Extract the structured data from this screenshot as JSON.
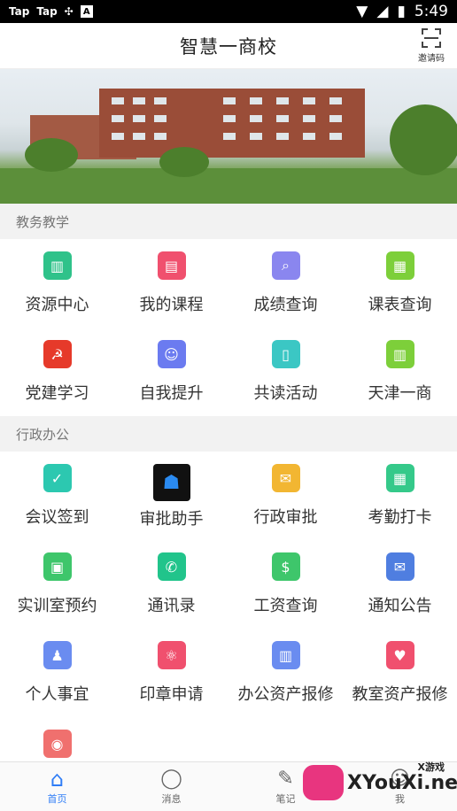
{
  "status_bar": {
    "left1": "Tap",
    "left2": "Tap",
    "time": "5:49"
  },
  "header": {
    "title": "智慧一商校",
    "scan_label": "邀请码"
  },
  "sections": [
    {
      "title": "教务教学"
    },
    {
      "title": "行政办公"
    }
  ],
  "edu_items": [
    {
      "label": "资源中心",
      "icon": "books-icon",
      "color": "#2fc28a"
    },
    {
      "label": "我的课程",
      "icon": "calendar-icon",
      "color": "#f0506e"
    },
    {
      "label": "成绩查询",
      "icon": "search-doc-icon",
      "color": "#8a86ef"
    },
    {
      "label": "课表查询",
      "icon": "schedule-icon",
      "color": "#7dcf3a"
    },
    {
      "label": "党建学习",
      "icon": "party-icon",
      "color": "#e63a2a"
    },
    {
      "label": "自我提升",
      "icon": "users-icon",
      "color": "#6b7bf0"
    },
    {
      "label": "共读活动",
      "icon": "book-icon",
      "color": "#3bc7c4"
    },
    {
      "label": "天津一商",
      "icon": "building-icon",
      "color": "#7dcf3a"
    }
  ],
  "admin_items": [
    {
      "label": "会议签到",
      "icon": "checkin-icon",
      "color": "#2cc8b0"
    },
    {
      "label": "审批助手",
      "icon": "approval-assistant-icon",
      "color": "#111111"
    },
    {
      "label": "行政审批",
      "icon": "envelope-icon",
      "color": "#f2b632"
    },
    {
      "label": "考勤打卡",
      "icon": "attendance-icon",
      "color": "#35c98a"
    },
    {
      "label": "实训室预约",
      "icon": "lab-icon",
      "color": "#3ec66b"
    },
    {
      "label": "通讯录",
      "icon": "phonebook-icon",
      "color": "#21c48b"
    },
    {
      "label": "工资查询",
      "icon": "salary-icon",
      "color": "#3ec66b"
    },
    {
      "label": "通知公告",
      "icon": "notice-icon",
      "color": "#4f7ee0"
    },
    {
      "label": "个人事宜",
      "icon": "person-icon",
      "color": "#6a8cf0"
    },
    {
      "label": "印章申请",
      "icon": "seal-icon",
      "color": "#f0506e"
    },
    {
      "label": "办公资产报修",
      "icon": "assets-icon",
      "color": "#6a8cf0"
    },
    {
      "label": "教室资产报修",
      "icon": "classroom-repair-icon",
      "color": "#f0506e"
    },
    {
      "label": "",
      "icon": "repair-icon",
      "color": "#f0706e"
    }
  ],
  "tabs": [
    {
      "label": "首页",
      "icon": "home-icon"
    },
    {
      "label": "消息",
      "icon": "message-icon"
    },
    {
      "label": "笔记",
      "icon": "note-icon"
    },
    {
      "label": "我",
      "icon": "me-icon"
    }
  ],
  "watermark": {
    "text": "XYouXi.net",
    "top_text": "X游戏"
  }
}
